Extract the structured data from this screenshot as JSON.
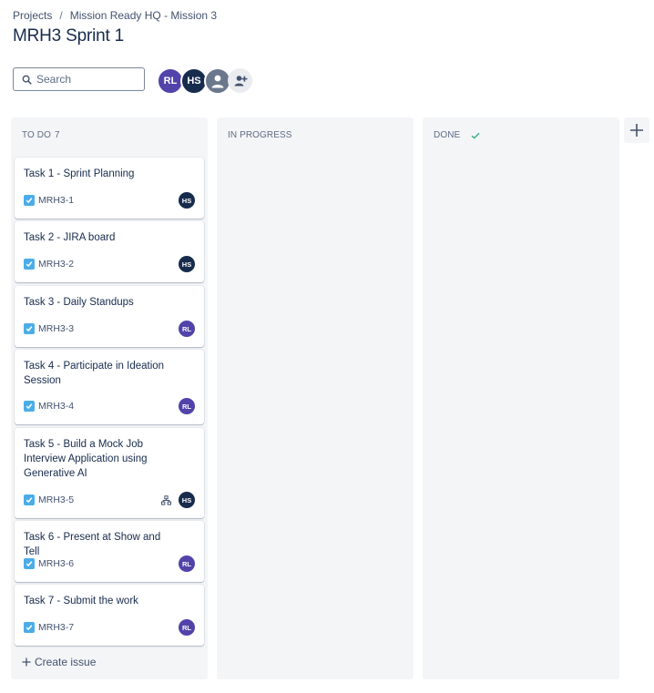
{
  "breadcrumb": {
    "items": [
      "Projects",
      "Mission Ready HQ - Mission 3"
    ],
    "separator": "/"
  },
  "board": {
    "title": "MRH3 Sprint 1"
  },
  "search": {
    "placeholder": "Search",
    "value": ""
  },
  "avatars": [
    {
      "initials": "RL",
      "color": "#5243aa"
    },
    {
      "initials": "HS",
      "color": "#172b4d"
    },
    {
      "initials": "",
      "color": "#6b778c",
      "icon": "person-icon"
    }
  ],
  "add_people": {
    "icon": "add-person-icon"
  },
  "columns": [
    {
      "name": "TO DO",
      "count": "7"
    },
    {
      "name": "IN PROGRESS",
      "count": ""
    },
    {
      "name": "DONE",
      "count": "",
      "icon": "check-icon"
    }
  ],
  "cards": [
    {
      "summary": "Task 1 - Sprint Planning",
      "key": "MRH3-1",
      "assignee": "HS",
      "assignee_color": "#172b4d"
    },
    {
      "summary": "Task 2 - JIRA board",
      "key": "MRH3-2",
      "assignee": "HS",
      "assignee_color": "#172b4d"
    },
    {
      "summary": "Task 3 - Daily Standups",
      "key": "MRH3-3",
      "assignee": "RL",
      "assignee_color": "#5243aa"
    },
    {
      "summary": "Task 4 - Participate in Ideation Session",
      "key": "MRH3-4",
      "assignee": "RL",
      "assignee_color": "#5243aa"
    },
    {
      "summary": "Task 5 - Build a Mock Job Interview Application using Generative AI",
      "key": "MRH3-5",
      "assignee": "HS",
      "assignee_color": "#172b4d",
      "child_issues_icon": true
    },
    {
      "summary": "Task 6 - Present at Show and Tell",
      "key": "MRH3-6",
      "assignee": "RL",
      "assignee_color": "#5243aa"
    },
    {
      "summary": "Task 7 - Submit the work",
      "key": "MRH3-7",
      "assignee": "RL",
      "assignee_color": "#5243aa"
    }
  ],
  "create_issue": {
    "label": "Create issue"
  },
  "colors": {
    "accent_task": "#4bade8",
    "done_check": "#36b37e",
    "column_bg": "#f4f5f7",
    "text": "#172b4d"
  }
}
